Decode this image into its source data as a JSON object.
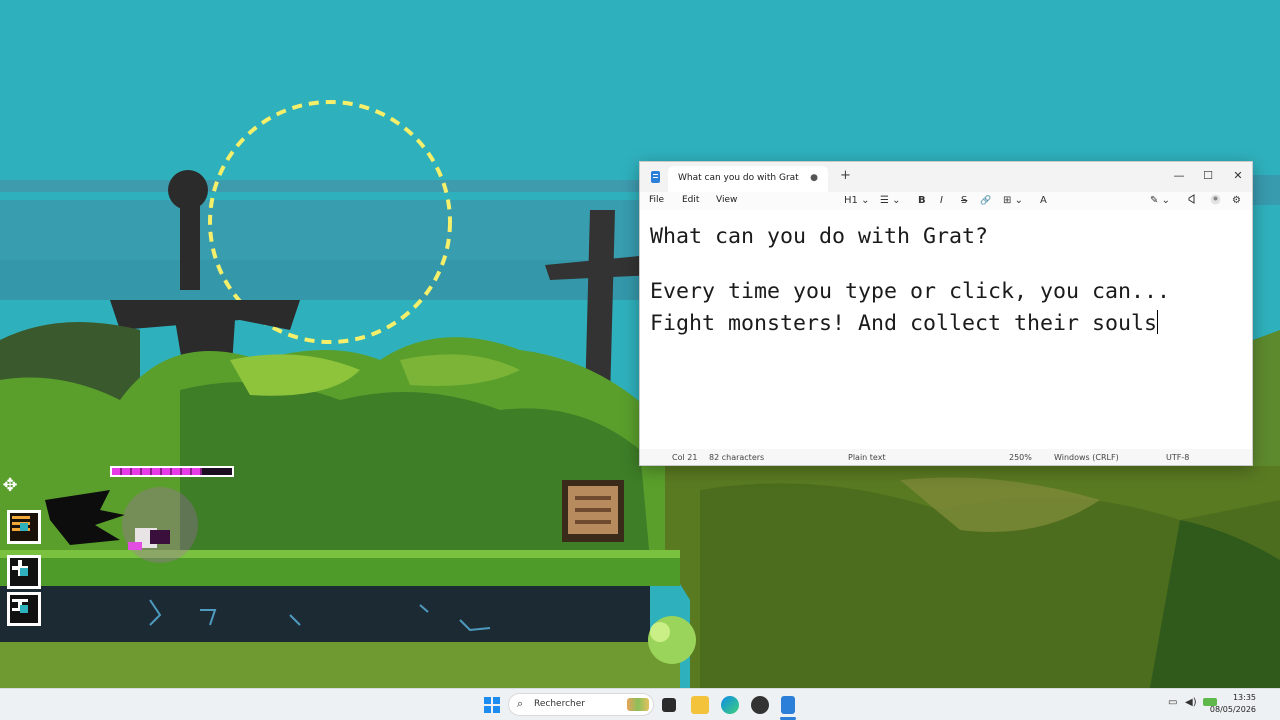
{
  "notepad": {
    "tab_title": "What can you do with Grat",
    "tab_unsaved": "●",
    "new_tab": "+",
    "controls": {
      "minimize": "—",
      "maximize": "☐",
      "close": "✕"
    },
    "menu": {
      "file": "File",
      "edit": "Edit",
      "view": "View"
    },
    "toolbar": {
      "heading": "H1",
      "list": "☰",
      "bold": "B",
      "italic": "I",
      "strike": "S",
      "link": "🔗",
      "table": "⊞",
      "spell": "A",
      "copilot": "✎",
      "settings": "⚙"
    },
    "content": {
      "line1": "What can you do with Grat?",
      "line2": "Every time you type or click, you can...",
      "line3": "Fight monsters! And collect their souls"
    },
    "status": {
      "position": "Col 21",
      "chars": "82 characters",
      "format": "Plain text",
      "zoom": "250%",
      "line_ending": "Windows (CRLF)",
      "encoding": "UTF-8"
    }
  },
  "game": {
    "move_handle": "✥",
    "health_fraction": 0.75
  },
  "taskbar": {
    "search_placeholder": "Rechercher",
    "time": "13:35",
    "date": "08/05/2026"
  }
}
